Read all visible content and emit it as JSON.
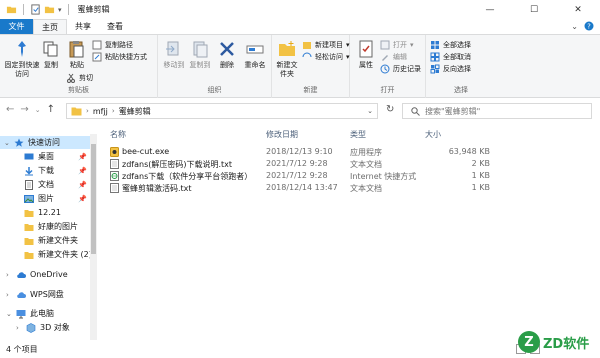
{
  "window": {
    "title": "蜜蜂剪辑",
    "controls": {
      "minimize": "—",
      "maximize": "☐",
      "close": "✕"
    }
  },
  "tabs": [
    "文件",
    "主页",
    "共享",
    "查看"
  ],
  "ribbon": {
    "clipboard": {
      "label": "剪贴板",
      "pin": "固定到快速访问",
      "copy": "复制",
      "paste": "粘贴",
      "copy_path": "复制路径",
      "paste_shortcut": "粘贴快捷方式",
      "cut": "剪切"
    },
    "organize": {
      "label": "组织",
      "move_to": "移动到",
      "copy_to": "复制到",
      "delete": "删除",
      "rename": "重命名"
    },
    "new": {
      "label": "新建",
      "new_folder": "新建文件夹",
      "new_item": "新建项目",
      "easy_access": "轻松访问"
    },
    "open": {
      "label": "打开",
      "properties": "属性",
      "open": "打开",
      "edit": "编辑",
      "history": "历史记录"
    },
    "select": {
      "label": "选择",
      "select_all": "全部选择",
      "select_none": "全部取消",
      "invert": "反向选择"
    }
  },
  "address": {
    "crumbs": [
      "mfjj",
      "蜜蜂剪辑"
    ],
    "search_placeholder": "搜索\"蜜蜂剪辑\""
  },
  "nav": {
    "items": [
      {
        "label": "快速访问",
        "pinned": false
      },
      {
        "label": "桌面",
        "pinned": true
      },
      {
        "label": "下载",
        "pinned": true
      },
      {
        "label": "文档",
        "pinned": true
      },
      {
        "label": "图片",
        "pinned": true
      },
      {
        "label": "12.21",
        "pinned": false
      },
      {
        "label": "好康的图片",
        "pinned": false
      },
      {
        "label": "新建文件夹",
        "pinned": false
      },
      {
        "label": "新建文件夹 (2)",
        "pinned": false
      },
      {
        "label": "OneDrive",
        "pinned": false
      },
      {
        "label": "WPS网盘",
        "pinned": false
      },
      {
        "label": "此电脑",
        "pinned": false
      },
      {
        "label": "3D 对象",
        "pinned": false
      }
    ]
  },
  "columns": {
    "name": "名称",
    "modified": "修改日期",
    "type": "类型",
    "size": "大小"
  },
  "files": [
    {
      "name": "bee-cut.exe",
      "modified": "2018/12/13 9:10",
      "type": "应用程序",
      "size": "63,948 KB",
      "icon": "exe-icon"
    },
    {
      "name": "zdfans(解压密码)下载说明.txt",
      "modified": "2021/7/12 9:28",
      "type": "文本文档",
      "size": "2 KB",
      "icon": "txt-icon"
    },
    {
      "name": "zdfans下载（软件分享平台领跑者）",
      "modified": "2021/7/12 9:28",
      "type": "Internet 快捷方式",
      "size": "1 KB",
      "icon": "url-icon"
    },
    {
      "name": "蜜蜂剪辑激活码.txt",
      "modified": "2018/12/14 13:47",
      "type": "文本文档",
      "size": "1 KB",
      "icon": "txt-icon"
    }
  ],
  "status": {
    "count": "4 个项目"
  },
  "watermark": {
    "letter": "Z",
    "text": "ZD软件"
  }
}
